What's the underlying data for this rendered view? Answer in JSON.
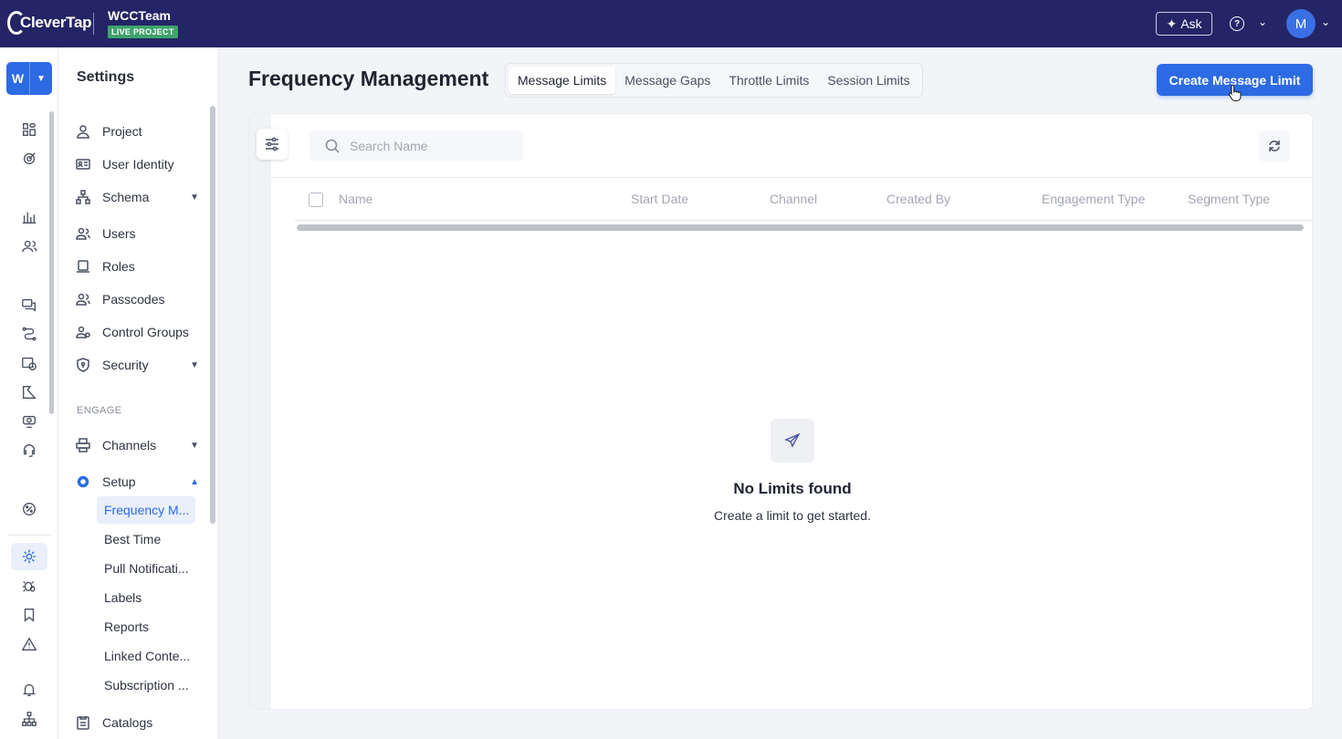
{
  "topbar": {
    "logo": "CleverTap",
    "project_name": "WCCTeam",
    "project_badge": "LIVE PROJECT",
    "ask_label": "Ask",
    "help_icon": "?",
    "avatar_initial": "M"
  },
  "rail": {
    "workspace_initial": "W"
  },
  "settings": {
    "title": "Settings",
    "items": {
      "project": "Project",
      "user_identity": "User Identity",
      "schema": "Schema",
      "users": "Users",
      "roles": "Roles",
      "passcodes": "Passcodes",
      "control_groups": "Control Groups",
      "security": "Security",
      "engage_section": "ENGAGE",
      "channels": "Channels",
      "setup": "Setup",
      "catalogs": "Catalogs"
    },
    "setup_subitems": [
      "Frequency M...",
      "Best Time",
      "Pull Notificati...",
      "Labels",
      "Reports",
      "Linked Conte...",
      "Subscription ..."
    ]
  },
  "header": {
    "title": "Frequency Management",
    "tabs": [
      "Message Limits",
      "Message Gaps",
      "Throttle Limits",
      "Session Limits"
    ],
    "active_tab": "Message Limits",
    "create_button": "Create Message Limit"
  },
  "table": {
    "search_placeholder": "Search Name",
    "columns": [
      "Name",
      "Start Date",
      "Channel",
      "Created By",
      "Engagement Type",
      "Segment Type"
    ]
  },
  "empty_state": {
    "title": "No Limits found",
    "subtitle": "Create a limit to get started."
  },
  "colors": {
    "topbar": "#232566",
    "accent": "#2d6be4",
    "badge": "#3ea36c"
  }
}
